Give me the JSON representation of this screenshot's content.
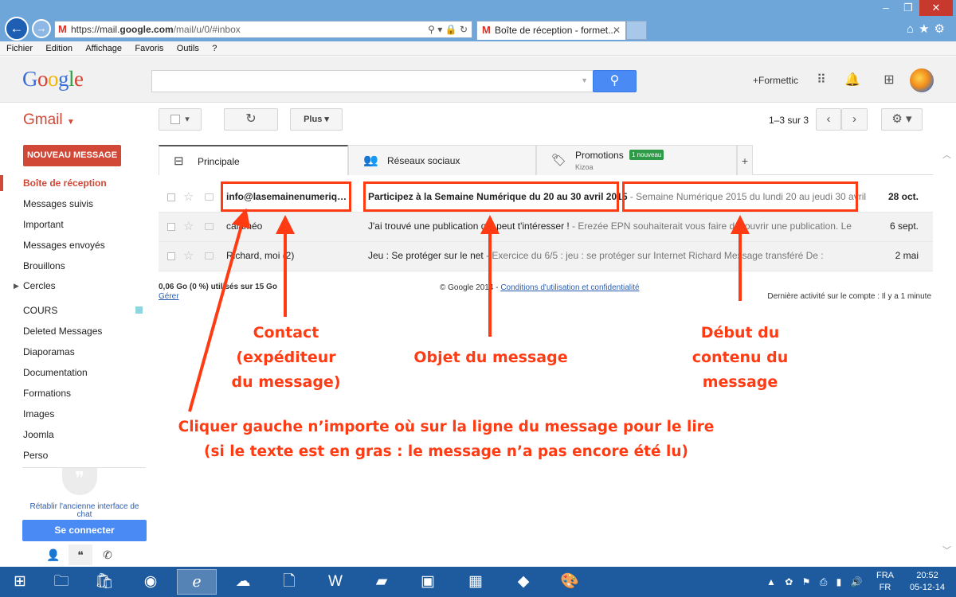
{
  "browser": {
    "url_prefix": "https://mail.",
    "url_domain": "google.com",
    "url_path": "/mail/u/0/#inbox",
    "tab_title": "Boîte de réception - formet...",
    "menu": [
      "Fichier",
      "Edition",
      "Affichage",
      "Favoris",
      "Outils",
      "?"
    ]
  },
  "header": {
    "logo": [
      "G",
      "o",
      "o",
      "g",
      "l",
      "e"
    ],
    "search_placeholder": "",
    "user_label": "+Formettic"
  },
  "toolbar": {
    "gmail_label": "Gmail",
    "more_label": "Plus",
    "pager": "1–3 sur 3"
  },
  "sidebar": {
    "compose_label": "NOUVEAU MESSAGE",
    "items": [
      {
        "label": "Boîte de réception",
        "active": true
      },
      {
        "label": "Messages suivis"
      },
      {
        "label": "Important"
      },
      {
        "label": "Messages envoyés"
      },
      {
        "label": "Brouillons"
      },
      {
        "label": "Cercles",
        "expandable": true
      },
      {
        "label": "COURS",
        "color": "#8dd6df"
      },
      {
        "label": "Deleted Messages"
      },
      {
        "label": "Diaporamas"
      },
      {
        "label": "Documentation"
      },
      {
        "label": "Formations"
      },
      {
        "label": "Images"
      },
      {
        "label": "Joomla"
      },
      {
        "label": "Perso"
      }
    ],
    "restore_chat": "Rétablir l'ancienne interface de chat",
    "signin": "Se connecter"
  },
  "tabs": {
    "primary": "Principale",
    "social": "Réseaux sociaux",
    "promotions": "Promotions",
    "promotions_badge": "1 nouveau",
    "promotions_sender": "Kizoa"
  },
  "messages": [
    {
      "sender": "info@lasemainenumerique..",
      "subject": "Participez à la Semaine Numérique du 20 au 30 avril 2015",
      "snippet": " - Semaine Numérique 2015 du lundi 20 au jeudi 30 avril",
      "date": "28 oct.",
      "unread": true
    },
    {
      "sender": "calaméo",
      "subject": "J'ai trouvé une publication qui peut t'intéresser !",
      "snippet": " - Erezée EPN souhaiterait vous faire découvrir une publication. Le",
      "date": "6 sept.",
      "unread": false
    },
    {
      "sender": "Richard, moi (2)",
      "subject": "Jeu : Se protéger sur le net",
      "snippet": " - Exercice du 6/5 : jeu : se protéger sur Internet Richard Message transféré De :",
      "date": "2 mai",
      "unread": false
    }
  ],
  "footer": {
    "quota": "0,06 Go (0 %) utilisés sur 15 Go",
    "manage": "Gérer",
    "copyright": "© Google 2014 - ",
    "terms": "Conditions d'utilisation et confidentialité",
    "last_activity": "Dernière activité sur le compte : Il y a 1 minute"
  },
  "annotations": {
    "contact": [
      "Contact",
      "(expéditeur",
      "du message)"
    ],
    "subject": "Objet du message",
    "content": [
      "Début du",
      "contenu du",
      "message"
    ],
    "instruction": [
      "Cliquer gauche n’importe où sur la ligne du message pour le lire",
      "(si le texte est en gras : le message n’a pas encore été lu)"
    ],
    "color": "#ff3b14"
  },
  "taskbar": {
    "lang": [
      "FRA",
      "FR"
    ],
    "time": "20:52",
    "date": "05-12-14"
  }
}
